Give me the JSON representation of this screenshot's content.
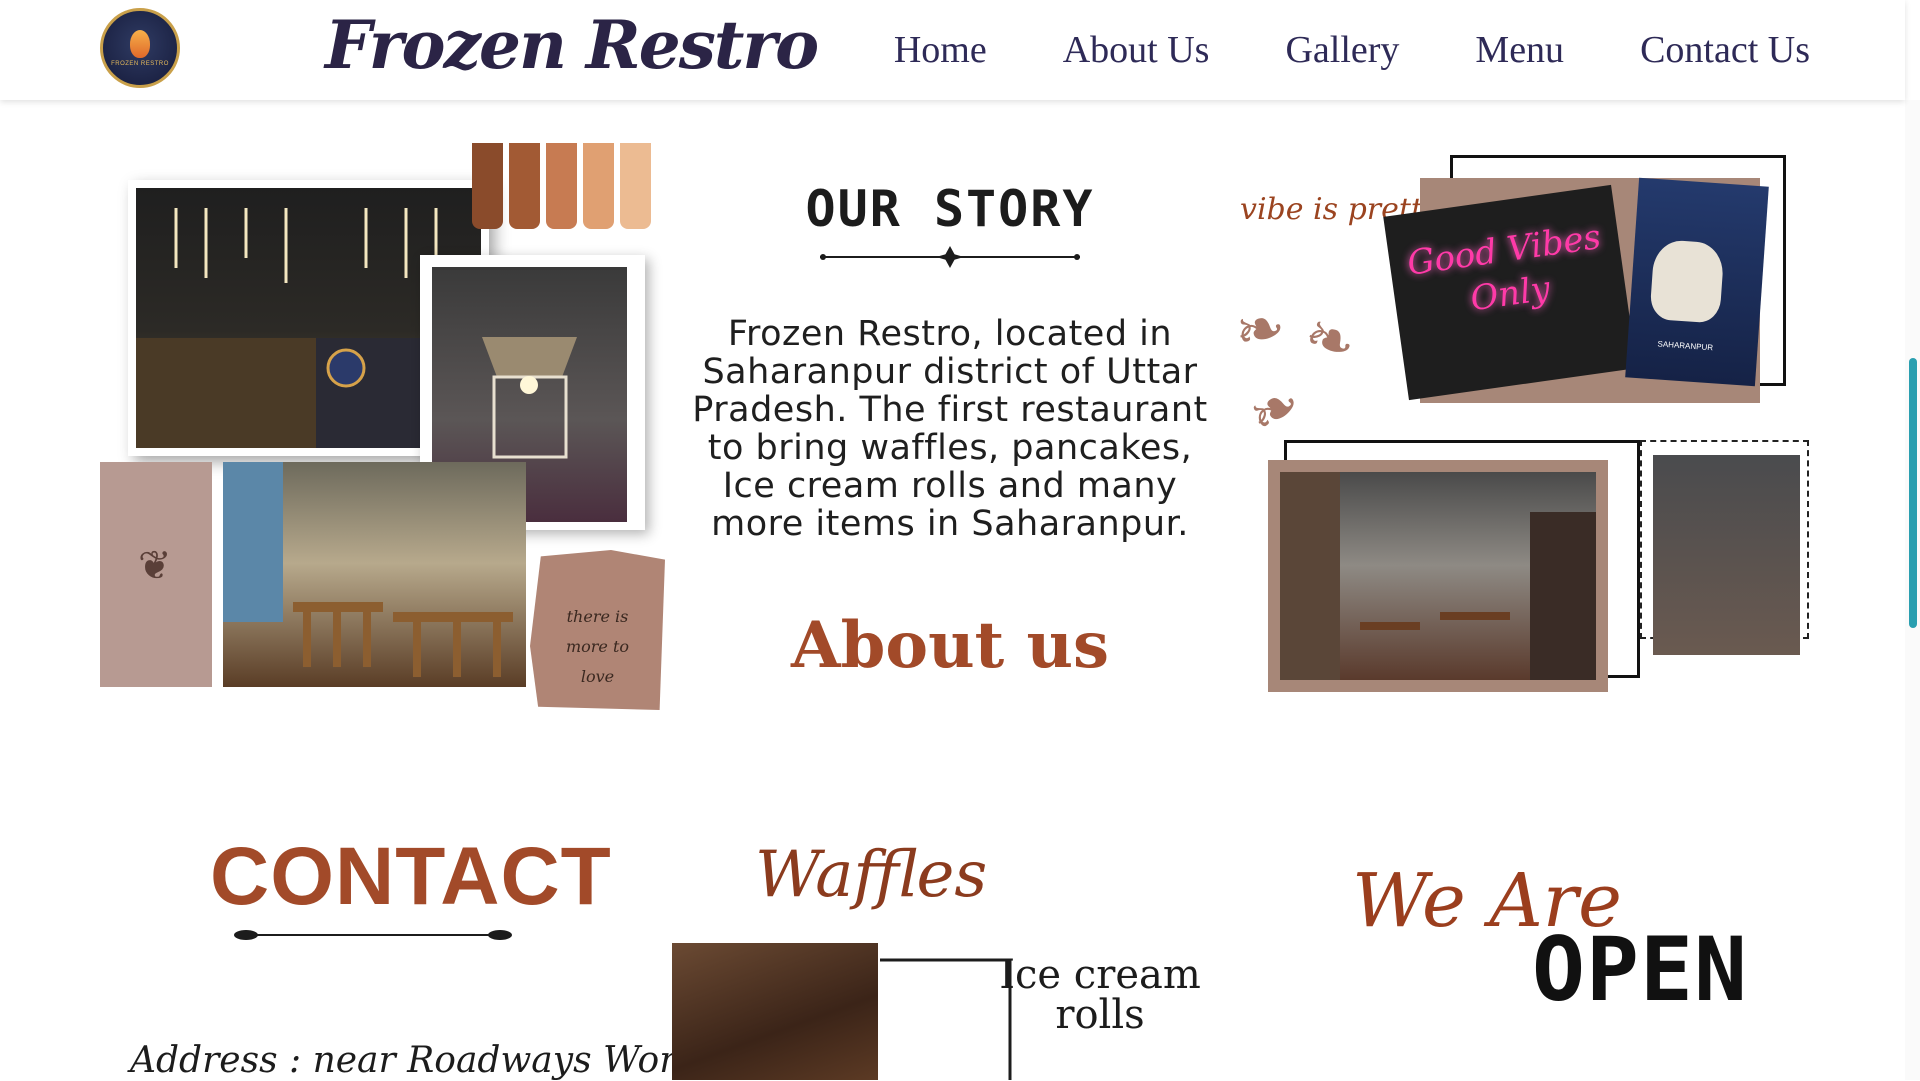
{
  "header": {
    "logo_text": "FROZEN RESTRO",
    "brand": "Frozen Restro",
    "nav": [
      "Home",
      "About Us",
      "Gallery",
      "Menu",
      "Contact Us"
    ]
  },
  "story": {
    "title": "OUR STORY",
    "text": "Frozen Restro, located in Saharanpur district of Uttar Pradesh. The first restaurant to bring waffles, pancakes, Ice cream rolls and many more items in Saharanpur.",
    "about_label": "About us"
  },
  "collage_left": {
    "note": [
      "there is",
      "more to",
      "love"
    ],
    "swatch_colors": [
      "#8a4b2b",
      "#a25a34",
      "#c77b52",
      "#e0a072",
      "#ecbb92"
    ]
  },
  "collage_right": {
    "vibe": "vibe is pretty",
    "neon": [
      "Good Vibes",
      "Only"
    ],
    "sign_caption": "SAHARANPUR"
  },
  "contact": {
    "title": "CONTACT",
    "address": "Address : near Roadways Workshop Rd,"
  },
  "menu_preview": {
    "waffles": "Waffles",
    "icecream": [
      "Ice cream",
      "rolls"
    ]
  },
  "open": {
    "we_are": "We Are",
    "open": "OPEN"
  },
  "colors": {
    "accent": "#a24a29",
    "nav_text": "#2e2a57",
    "scroll_thumb": "#2a9fb0"
  }
}
